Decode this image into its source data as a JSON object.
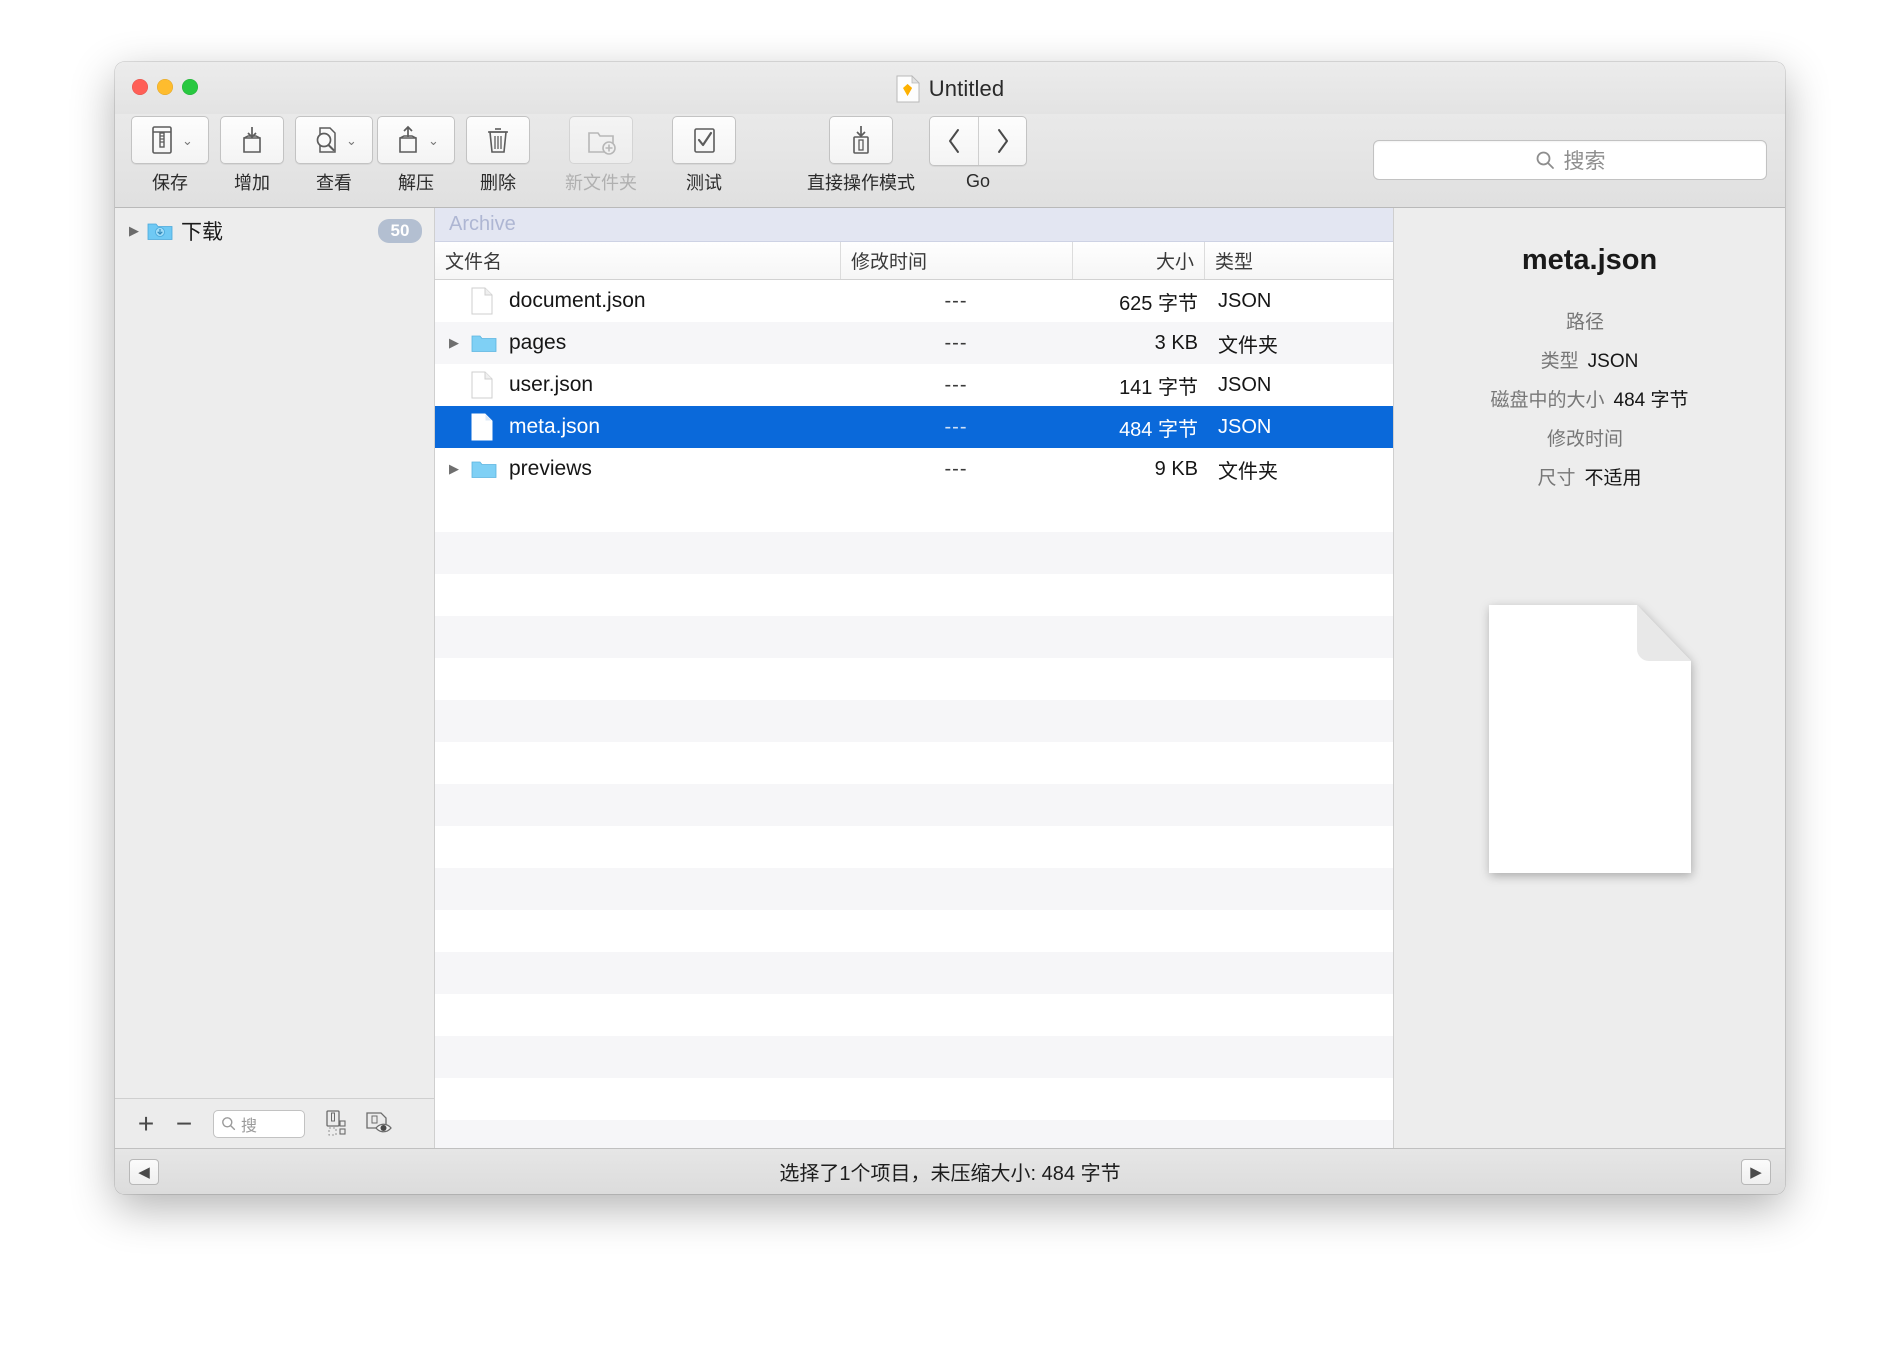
{
  "window": {
    "title": "Untitled",
    "title_icon": "sketch-document-icon"
  },
  "toolbar": {
    "items": [
      {
        "label": "保存",
        "icon": "archive-save-icon",
        "has_menu": true,
        "enabled": true
      },
      {
        "label": "增加",
        "icon": "add-to-archive-icon",
        "has_menu": false,
        "enabled": true
      },
      {
        "label": "查看",
        "icon": "preview-magnifier-icon",
        "has_menu": true,
        "enabled": true
      },
      {
        "label": "解压",
        "icon": "extract-icon",
        "has_menu": true,
        "enabled": true
      },
      {
        "label": "删除",
        "icon": "trash-icon",
        "has_menu": false,
        "enabled": true
      },
      {
        "label": "新文件夹",
        "icon": "new-folder-icon",
        "has_menu": false,
        "enabled": false
      },
      {
        "label": "测试",
        "icon": "test-checkmark-icon",
        "has_menu": false,
        "enabled": true
      },
      {
        "label": "直接操作模式",
        "icon": "direct-mode-icon",
        "has_menu": false,
        "enabled": true
      }
    ],
    "nav": {
      "label": "Go",
      "back_icon": "chevron-left-icon",
      "forward_icon": "chevron-right-icon"
    },
    "search": {
      "placeholder": "搜索",
      "value": "",
      "icon": "search-icon"
    }
  },
  "sidebar": {
    "items": [
      {
        "label": "下载",
        "badge": "50",
        "icon": "downloads-folder-icon",
        "expanded": false
      }
    ],
    "bottom": {
      "add_label": "+",
      "remove_label": "−",
      "search_placeholder": "搜",
      "search_value": "",
      "icons": [
        "extract-to-folder-icon",
        "quick-look-icon"
      ]
    }
  },
  "path_bar": {
    "text": "Archive"
  },
  "file_list": {
    "columns": [
      "文件名",
      "修改时间",
      "大小",
      "类型"
    ],
    "rows": [
      {
        "name": "document.json",
        "mtime": "---",
        "size": "625 字节",
        "type": "JSON",
        "icon": "file-icon",
        "expandable": false,
        "selected": false
      },
      {
        "name": "pages",
        "mtime": "---",
        "size": "3 KB",
        "type": "文件夹",
        "icon": "folder-icon",
        "expandable": true,
        "selected": false
      },
      {
        "name": "user.json",
        "mtime": "---",
        "size": "141 字节",
        "type": "JSON",
        "icon": "file-icon",
        "expandable": false,
        "selected": false
      },
      {
        "name": "meta.json",
        "mtime": "---",
        "size": "484 字节",
        "type": "JSON",
        "icon": "file-icon",
        "expandable": false,
        "selected": true
      },
      {
        "name": "previews",
        "mtime": "---",
        "size": "9 KB",
        "type": "文件夹",
        "icon": "folder-icon",
        "expandable": true,
        "selected": false
      }
    ]
  },
  "info_panel": {
    "title": "meta.json",
    "fields": [
      {
        "key": "路径",
        "value": ""
      },
      {
        "key": "类型",
        "value": "JSON"
      },
      {
        "key": "磁盘中的大小",
        "value": "484 字节"
      },
      {
        "key": "修改时间",
        "value": ""
      },
      {
        "key": "尺寸",
        "value": "不适用"
      }
    ],
    "preview_icon": "blank-document-preview"
  },
  "status_bar": {
    "text": "选择了1个项目，未压缩大小: 484 字节",
    "left_icon": "nav-left-icon",
    "right_icon": "nav-right-icon"
  },
  "colors": {
    "selection_blue": "#0a69da",
    "badge_blue": "#b3bfd1",
    "path_bar_bg": "#e3e6f2",
    "folder_blue": "#6fc9f4"
  }
}
